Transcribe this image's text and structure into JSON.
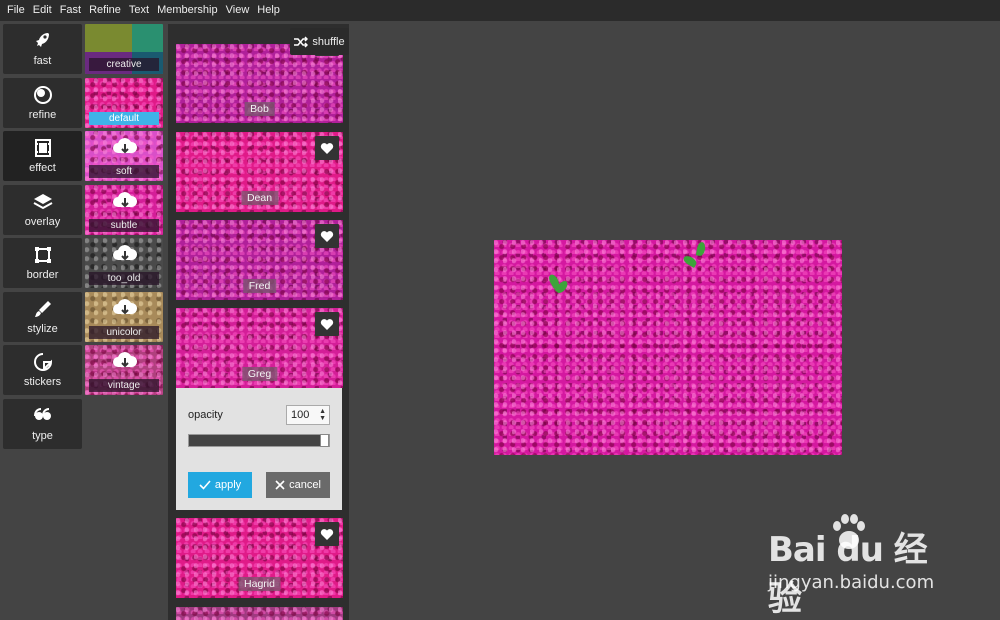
{
  "menubar": {
    "items": [
      "File",
      "Edit",
      "Fast",
      "Refine",
      "Text",
      "Membership",
      "View",
      "Help"
    ]
  },
  "tools": [
    {
      "label": "fast",
      "icon": "rocket-icon"
    },
    {
      "label": "refine",
      "icon": "refine-icon"
    },
    {
      "label": "effect",
      "icon": "film-icon"
    },
    {
      "label": "overlay",
      "icon": "layers-icon"
    },
    {
      "label": "border",
      "icon": "border-icon"
    },
    {
      "label": "stylize",
      "icon": "brush-icon"
    },
    {
      "label": "stickers",
      "icon": "sticker-icon"
    },
    {
      "label": "type",
      "icon": "quote-icon"
    }
  ],
  "presets": [
    {
      "label": "creative"
    },
    {
      "label": "default",
      "selected": true
    },
    {
      "label": "soft"
    },
    {
      "label": "subtle"
    },
    {
      "label": "too_old"
    },
    {
      "label": "unicolor"
    },
    {
      "label": "vintage"
    }
  ],
  "shuffle_label": "shuffle",
  "filters": [
    {
      "name": "Bob"
    },
    {
      "name": "Dean"
    },
    {
      "name": "Fred"
    },
    {
      "name": "Greg"
    },
    {
      "name": "Hagrid"
    }
  ],
  "opacity_panel": {
    "label": "opacity",
    "value": "100",
    "level_percent": 100,
    "apply_label": "apply",
    "cancel_label": "cancel"
  },
  "watermark": {
    "brand": "Bai du 经验",
    "url": "jingyan.baidu.com"
  },
  "colors": {
    "accent": "#22a8e0",
    "selected_preset": "#3fb3e8",
    "background": "#444444"
  }
}
